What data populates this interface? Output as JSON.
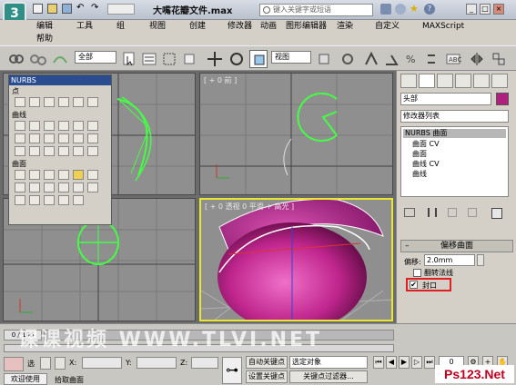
{
  "titlebar": {
    "app_logo": "3",
    "doc_title": "大嘴花瓣文件.max",
    "search_placeholder": "键入关键字或短语"
  },
  "menu": {
    "row1": [
      "编辑",
      "工具",
      "组",
      "视图",
      "创建",
      "修改器",
      "动画",
      "图形编辑器",
      "渲染",
      "自定义",
      "MAXScript"
    ],
    "row2": [
      "帮助"
    ]
  },
  "toolbar": {
    "selection_filter": "全部",
    "view_select": "视图"
  },
  "viewports": {
    "top_label": "",
    "front_label": "[ + 0 前 ]",
    "left_label": "",
    "persp_label": "[ + 0 透视 0 平滑 + 高光 ]"
  },
  "nurbs": {
    "title": "NURBS",
    "section_point": "点",
    "section_curve": "曲线",
    "section_surface": "曲面"
  },
  "command_panel": {
    "object_name": "头部",
    "modifier_list": "修改器列表",
    "stack": [
      "NURBS 曲面",
      "曲面 CV",
      "曲面",
      "曲线 CV",
      "曲线"
    ],
    "rollout_title": "偏移曲面",
    "offset_label": "偏移:",
    "offset_value": "2.0mm",
    "flip_normals_label": "翻转法线",
    "cap_label": "封口",
    "cap_checked": "✔"
  },
  "bottom": {
    "frame_counter": "0 / 100",
    "watermark": "课课视频 WWW.TLVI.NET",
    "select_label": "选",
    "x_label": "X:",
    "y_label": "Y:",
    "z_label": "Z:",
    "auto_key": "自动关键点",
    "selected_object": "选定对象",
    "set_key": "设置关键点",
    "key_filters": "关键点过滤器...",
    "welcome": "欢迎使用",
    "prompt": "拾取曲面",
    "frame_value": "0",
    "site_logo": "Ps123.Net"
  },
  "colors": {
    "nurbs_green": "#44ff44",
    "sphere_magenta": "#c0268e",
    "selected_border": "#e8e830",
    "cap_highlight": "#e02020"
  }
}
